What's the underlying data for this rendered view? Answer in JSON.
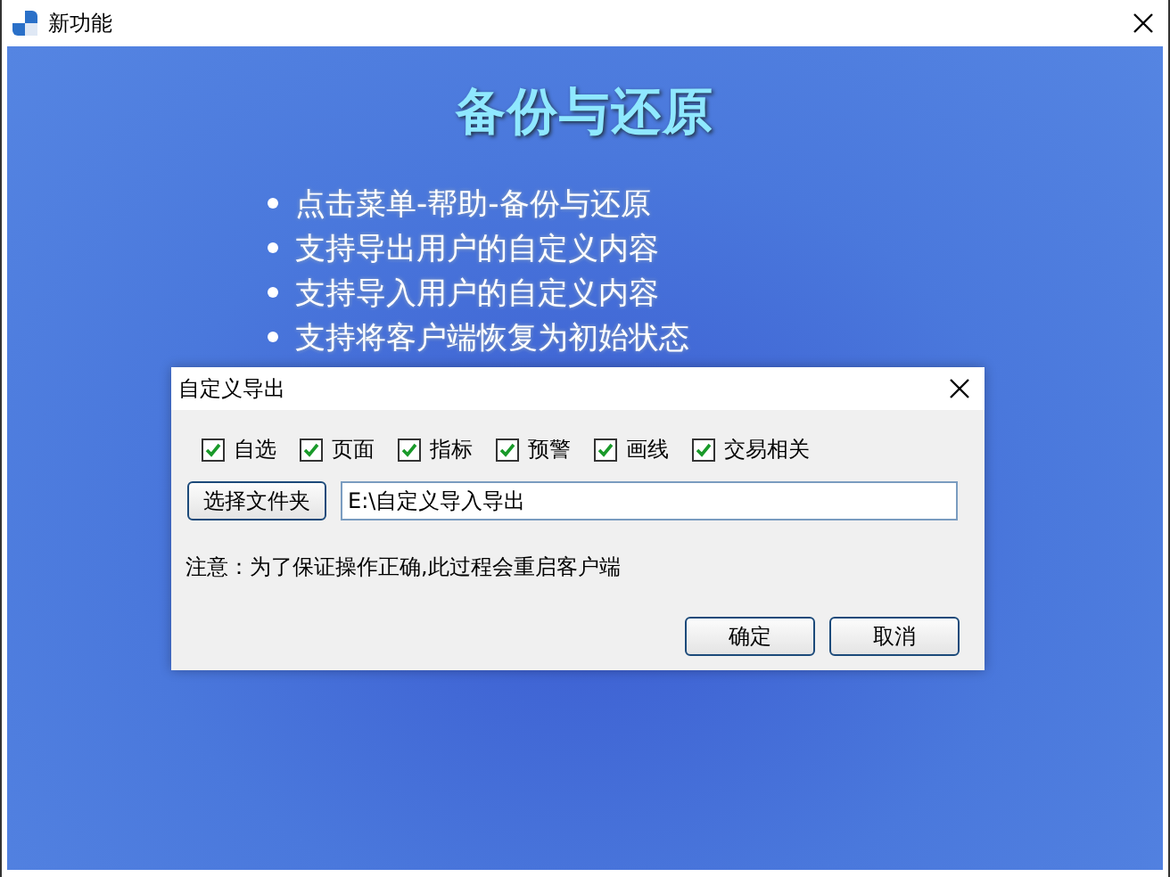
{
  "window": {
    "title": "新功能"
  },
  "banner": {
    "heading": "备份与还原",
    "bullets": [
      "点击菜单-帮助-备份与还原",
      "支持导出用户的自定义内容",
      "支持导入用户的自定义内容",
      "支持将客户端恢复为初始状态"
    ]
  },
  "dialog": {
    "title": "自定义导出",
    "options": [
      {
        "label": "自选",
        "checked": true
      },
      {
        "label": "页面",
        "checked": true
      },
      {
        "label": "指标",
        "checked": true
      },
      {
        "label": "预警",
        "checked": true
      },
      {
        "label": "画线",
        "checked": true
      },
      {
        "label": "交易相关",
        "checked": true
      }
    ],
    "folder_button": "选择文件夹",
    "path": "E:\\自定义导入导出",
    "note": "注意：为了保证操作正确,此过程会重启客户端",
    "buttons": [
      "确定",
      "取消"
    ]
  }
}
